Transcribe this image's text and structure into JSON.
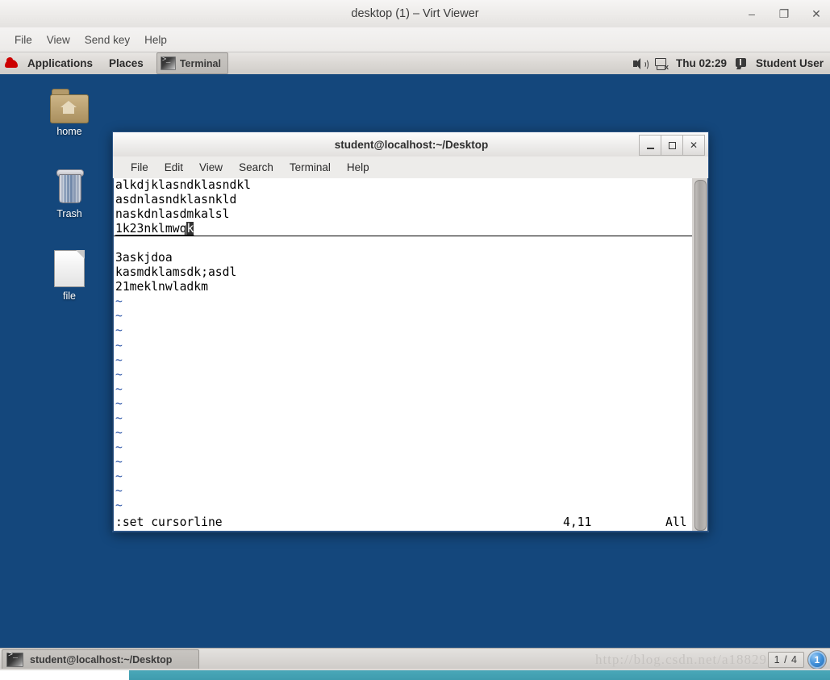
{
  "viewer": {
    "title": "desktop (1) – Virt Viewer",
    "window_buttons": [
      {
        "name": "minimize",
        "glyph": "‒"
      },
      {
        "name": "maximize",
        "glyph": "❐"
      },
      {
        "name": "close",
        "glyph": "✕"
      }
    ],
    "menu": [
      "File",
      "View",
      "Send key",
      "Help"
    ]
  },
  "panel": {
    "applications_label": "Applications",
    "places_label": "Places",
    "window_label": "Terminal",
    "clock": "Thu 02:29",
    "user": "Student User",
    "icons": [
      "redhat-logo",
      "terminal-icon",
      "volume-icon",
      "network-disconnected-icon",
      "user-message-icon"
    ]
  },
  "desktop": {
    "background_color": "#14477c",
    "icons": [
      {
        "label": "home",
        "icon": "home-folder-icon"
      },
      {
        "label": "Trash",
        "icon": "trash-icon"
      },
      {
        "label": "file",
        "icon": "file-icon"
      }
    ]
  },
  "terminal": {
    "title": "student@localhost:~/Desktop",
    "menu": [
      "File",
      "Edit",
      "View",
      "Search",
      "Terminal",
      "Help"
    ],
    "window_buttons": [
      {
        "name": "minimize",
        "glyph": "_"
      },
      {
        "name": "maximize",
        "glyph": "□"
      },
      {
        "name": "close",
        "glyph": "✕"
      }
    ],
    "editor": {
      "lines": [
        {
          "text": "alkdjklasndklasndkl",
          "type": "text"
        },
        {
          "text": "asdnlasndklasnkld",
          "type": "text"
        },
        {
          "text": "naskdnlasdmkalsl",
          "type": "text"
        },
        {
          "text": "1k23nklmwq",
          "type": "cursorline",
          "cursor_char": "k"
        },
        {
          "text": "",
          "type": "text"
        },
        {
          "text": "3askjdoa",
          "type": "text"
        },
        {
          "text": "kasmdklamsdk;asdl",
          "type": "text"
        },
        {
          "text": "21meklnwladkm",
          "type": "text"
        },
        {
          "text": "~",
          "type": "nontext"
        },
        {
          "text": "~",
          "type": "nontext"
        },
        {
          "text": "~",
          "type": "nontext"
        },
        {
          "text": "~",
          "type": "nontext"
        },
        {
          "text": "~",
          "type": "nontext"
        },
        {
          "text": "~",
          "type": "nontext"
        },
        {
          "text": "~",
          "type": "nontext"
        },
        {
          "text": "~",
          "type": "nontext"
        },
        {
          "text": "~",
          "type": "nontext"
        },
        {
          "text": "~",
          "type": "nontext"
        },
        {
          "text": "~",
          "type": "nontext"
        },
        {
          "text": "~",
          "type": "nontext"
        },
        {
          "text": "~",
          "type": "nontext"
        },
        {
          "text": "~",
          "type": "nontext"
        },
        {
          "text": "~",
          "type": "nontext"
        }
      ],
      "status": {
        "command": ":set cursorline",
        "position": "4,11",
        "scroll": "All"
      }
    }
  },
  "taskbar": {
    "window_label": "student@localhost:~/Desktop",
    "workspace_indicator": "1 / 4",
    "notification_badge": "1"
  },
  "watermark": "http://blog.csdn.net/a18829"
}
